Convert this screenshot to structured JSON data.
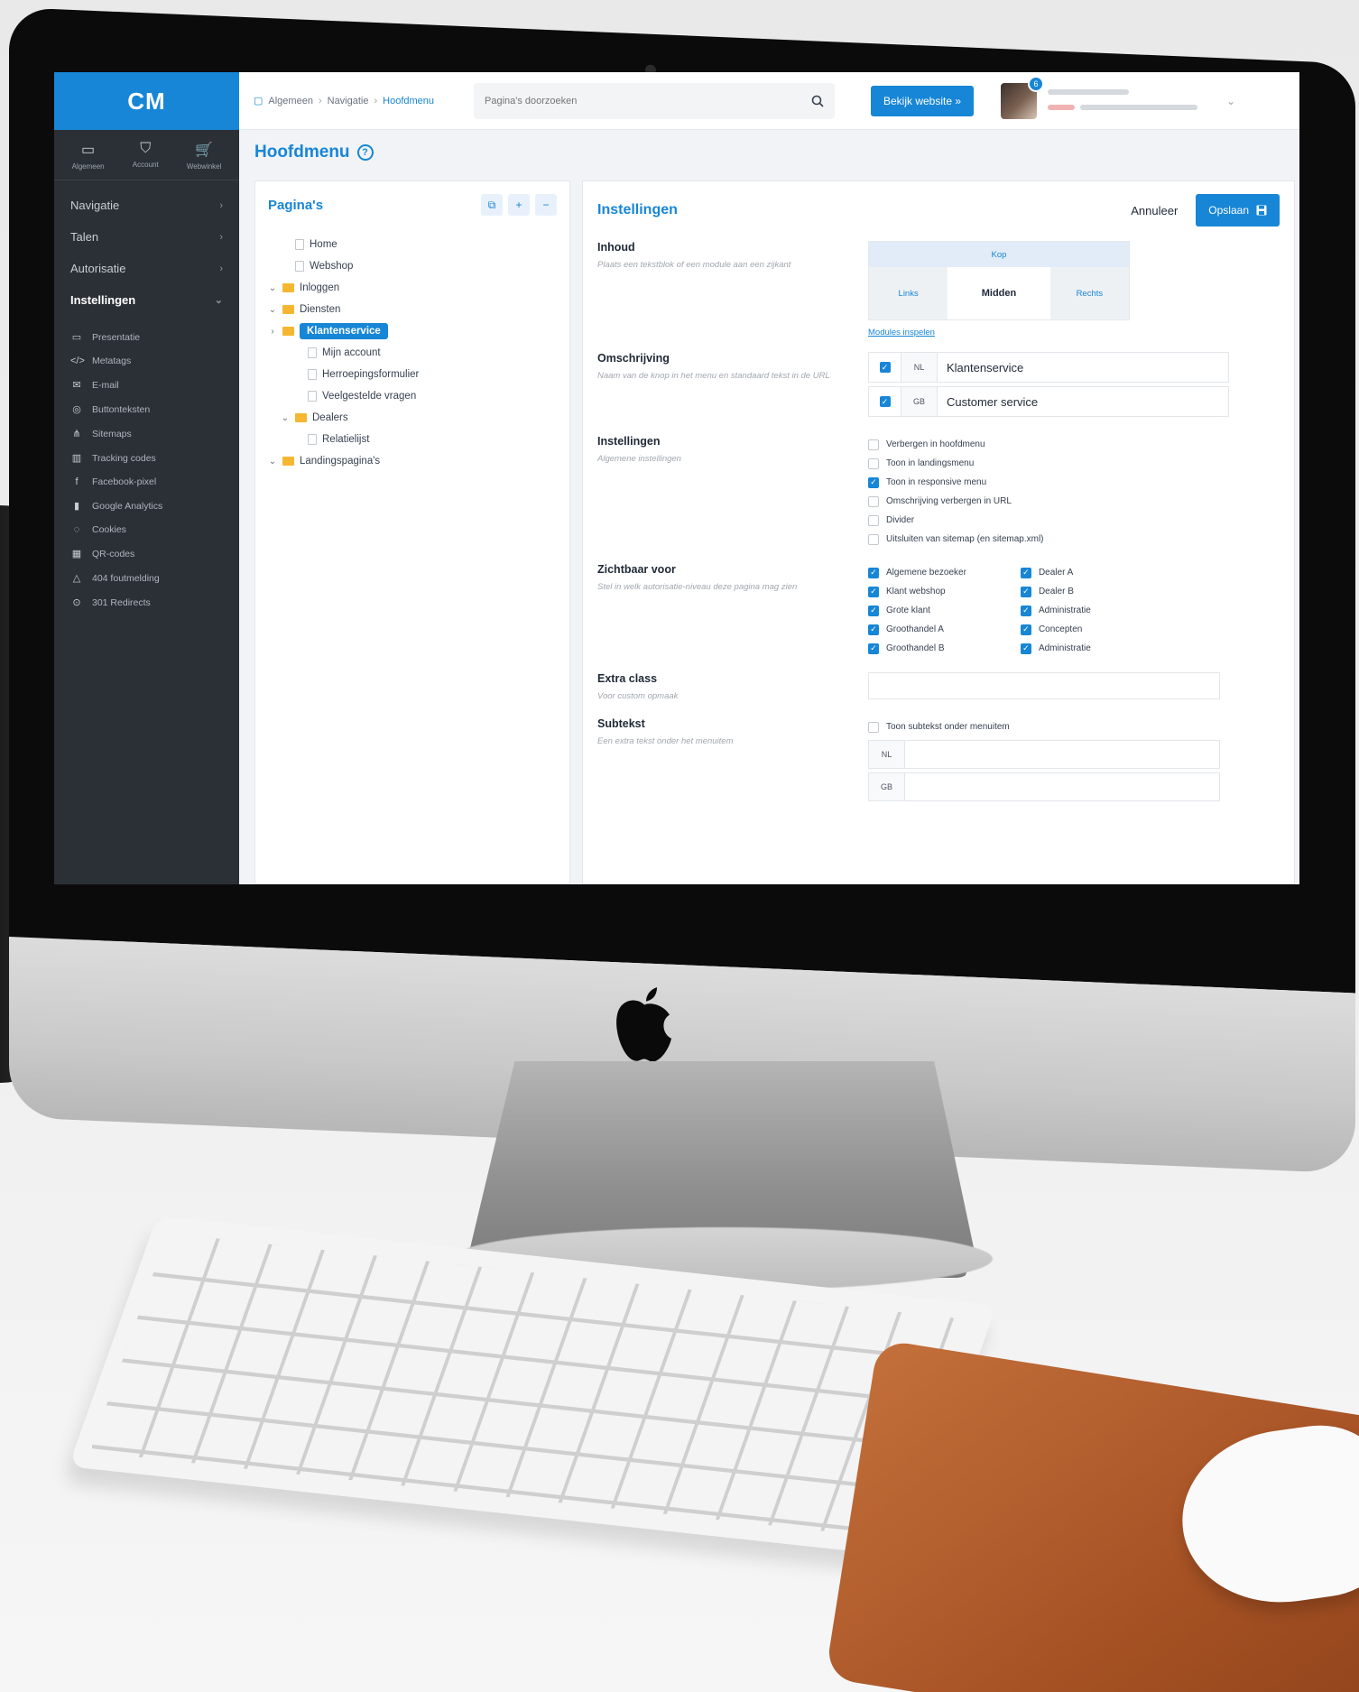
{
  "app": {
    "logo_text": "CM",
    "brand_color": "#1786d6",
    "sidebar_color": "#2b3036"
  },
  "sidebar": {
    "top_icons": [
      {
        "icon": "monitor-icon",
        "label": "Algemeen"
      },
      {
        "icon": "shield-icon",
        "label": "Account"
      },
      {
        "icon": "cart-icon",
        "label": "Webwinkel"
      }
    ],
    "nav": [
      {
        "label": "Navigatie",
        "caret": "›"
      },
      {
        "label": "Talen",
        "caret": "›"
      },
      {
        "label": "Autorisatie",
        "caret": "›"
      },
      {
        "label": "Instellingen",
        "caret": "⌄"
      }
    ],
    "sub_items": [
      {
        "icon": "presentation-icon",
        "glyph": "▭",
        "label": "Presentatie"
      },
      {
        "icon": "code-icon",
        "glyph": "</>",
        "label": "Metatags"
      },
      {
        "icon": "email-icon",
        "glyph": "✉",
        "label": "E-mail"
      },
      {
        "icon": "button-icon",
        "glyph": "◎",
        "label": "Buttonteksten"
      },
      {
        "icon": "sitemap-icon",
        "glyph": "⋔",
        "label": "Sitemaps"
      },
      {
        "icon": "tracking-icon",
        "glyph": "▥",
        "label": "Tracking codes"
      },
      {
        "icon": "facebook-icon",
        "glyph": "f",
        "label": "Facebook-pixel"
      },
      {
        "icon": "analytics-icon",
        "glyph": "▮",
        "label": "Google Analytics"
      },
      {
        "icon": "cookie-icon",
        "glyph": "◌",
        "label": "Cookies"
      },
      {
        "icon": "qr-icon",
        "glyph": "▦",
        "label": "QR-codes"
      },
      {
        "icon": "warning-icon",
        "glyph": "△",
        "label": "404 foutmelding"
      },
      {
        "icon": "redirect-icon",
        "glyph": "⊙",
        "label": "301 Redirects"
      }
    ]
  },
  "topbar": {
    "breadcrumb": [
      "Algemeen",
      "Navigatie",
      "Hoofdmenu"
    ],
    "breadcrumb_sep": "›",
    "search_placeholder": "Pagina's doorzoeken",
    "visit_button": "Bekijk website »",
    "notification_count": "6"
  },
  "page": {
    "title": "Hoofdmenu",
    "help": "?"
  },
  "pages_panel": {
    "title": "Pagina's",
    "tools": [
      "⧉",
      "+",
      "−"
    ],
    "tree": [
      {
        "label": "Home",
        "kind": "file",
        "depth": 1,
        "chev": ""
      },
      {
        "label": "Webshop",
        "kind": "file",
        "depth": 1,
        "chev": ""
      },
      {
        "label": "Inloggen",
        "kind": "folder",
        "depth": 0,
        "chev": "⌄"
      },
      {
        "label": "Diensten",
        "kind": "folder",
        "depth": 0,
        "chev": "⌄"
      },
      {
        "label": "Klantenservice",
        "kind": "folder",
        "depth": 0,
        "chev": "›",
        "selected": true
      },
      {
        "label": "Mijn account",
        "kind": "file",
        "depth": 2,
        "chev": ""
      },
      {
        "label": "Herroepingsformulier",
        "kind": "file",
        "depth": 2,
        "chev": ""
      },
      {
        "label": "Veelgestelde vragen",
        "kind": "file",
        "depth": 2,
        "chev": ""
      },
      {
        "label": "Dealers",
        "kind": "folder",
        "depth": 1,
        "chev": "⌄"
      },
      {
        "label": "Relatielijst",
        "kind": "file",
        "depth": 2,
        "chev": ""
      },
      {
        "label": "Landingspagina's",
        "kind": "folder",
        "depth": 0,
        "chev": "⌄"
      }
    ]
  },
  "settings": {
    "title": "Instellingen",
    "cancel": "Annuleer",
    "save": "Opslaan",
    "inhoud": {
      "label": "Inhoud",
      "desc": "Plaats een tekstblok of een module aan een zijkant",
      "top": "Kop",
      "left": "Links",
      "middle": "Midden",
      "right": "Rechts",
      "link": "Modules inspelen"
    },
    "omschrijving": {
      "label": "Omschrijving",
      "desc": "Naam van de knop in het menu en standaard tekst in de URL",
      "langs": [
        {
          "code": "NL",
          "value": "Klantenservice"
        },
        {
          "code": "GB",
          "value": "Customer service"
        }
      ]
    },
    "instellingen": {
      "label": "Instellingen",
      "desc": "Algemene instellingen",
      "options": [
        {
          "label": "Verbergen in hoofdmenu",
          "checked": false
        },
        {
          "label": "Toon in landingsmenu",
          "checked": false
        },
        {
          "label": "Toon in responsive menu",
          "checked": true
        },
        {
          "label": "Omschrijving verbergen in URL",
          "checked": false
        },
        {
          "label": "Divider",
          "checked": false
        },
        {
          "label": "Uitsluiten van sitemap (en sitemap.xml)",
          "checked": false
        }
      ]
    },
    "zichtbaar": {
      "label": "Zichtbaar voor",
      "desc": "Stel in welk autorisatie-niveau deze pagina mag zien",
      "col1": [
        {
          "label": "Algemene bezoeker",
          "checked": true
        },
        {
          "label": "Klant webshop",
          "checked": true
        },
        {
          "label": "Grote klant",
          "checked": true
        },
        {
          "label": "Groothandel A",
          "checked": true
        },
        {
          "label": "Groothandel B",
          "checked": true
        }
      ],
      "col2": [
        {
          "label": "Dealer A",
          "checked": true
        },
        {
          "label": "Dealer B",
          "checked": true
        },
        {
          "label": "Administratie",
          "checked": true
        },
        {
          "label": "Concepten",
          "checked": true
        },
        {
          "label": "Administratie",
          "checked": true
        }
      ]
    },
    "extra_class": {
      "label": "Extra class",
      "desc": "Voor custom opmaak"
    },
    "subtekst": {
      "label": "Subtekst",
      "desc": "Een extra tekst onder het menuitem",
      "toggle": "Toon subtekst onder menuitem",
      "langs": [
        {
          "code": "NL"
        },
        {
          "code": "GB"
        }
      ]
    }
  }
}
